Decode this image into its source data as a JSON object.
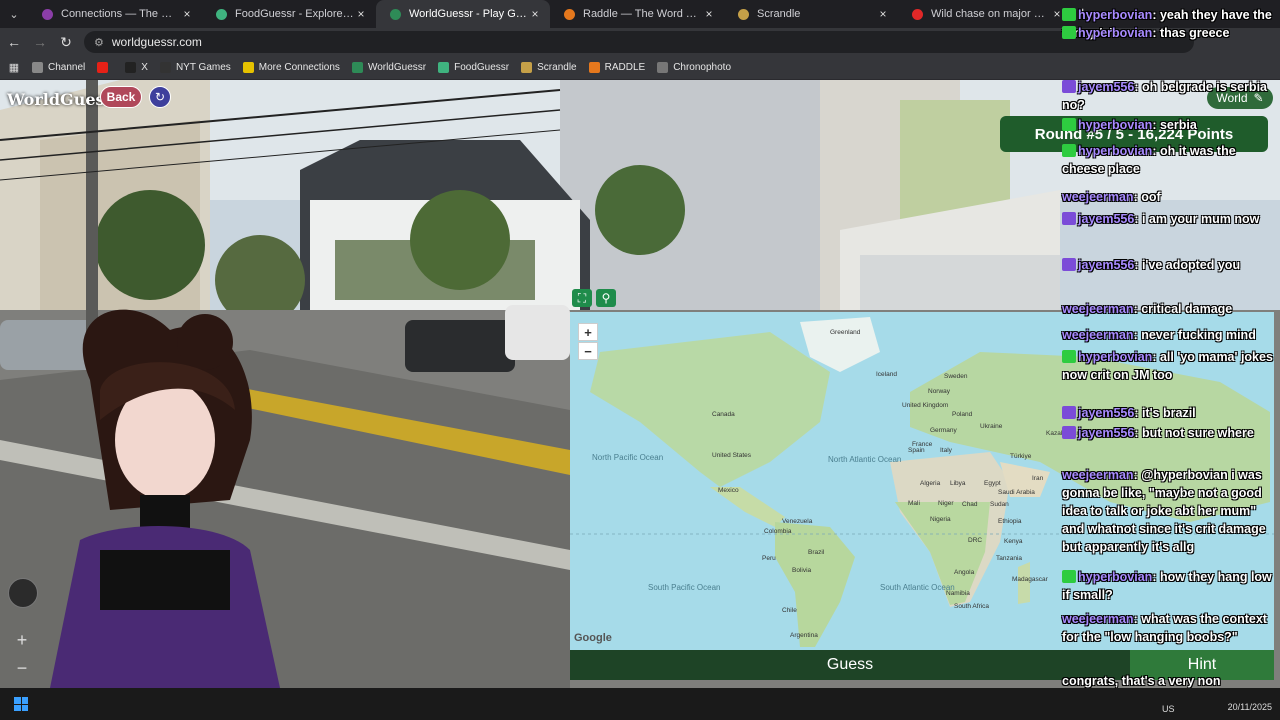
{
  "browser": {
    "tabs": [
      {
        "title": "Connections — The New York T",
        "color": "#8b3ea8"
      },
      {
        "title": "FoodGuessr - Explore the world",
        "color": "#3fb37f"
      },
      {
        "title": "WorldGuessr - Play Geoguessr",
        "color": "#2e8b57",
        "active": true
      },
      {
        "title": "Raddle — The Word Transforma",
        "color": "#e5781d"
      },
      {
        "title": "Scrandle",
        "color": "#c5a048"
      },
      {
        "title": "Wild chase on major Perth high",
        "color": "#e12828"
      }
    ],
    "address": "worldguessr.com",
    "bookmarks": [
      {
        "label": "Channel",
        "color": "#888"
      },
      {
        "label": "",
        "color": "#e62117"
      },
      {
        "label": "X",
        "color": "#222"
      },
      {
        "label": "NYT Games",
        "color": "#333"
      },
      {
        "label": "More Connections",
        "color": "#e6c200"
      },
      {
        "label": "WorldGuessr",
        "color": "#2e8b57"
      },
      {
        "label": "FoodGuessr",
        "color": "#3fb37f"
      },
      {
        "label": "Scrandle",
        "color": "#c5a048"
      },
      {
        "label": "RADDLE",
        "color": "#e5781d"
      },
      {
        "label": "Chronophoto",
        "color": "#777"
      }
    ]
  },
  "game": {
    "logo": "WorldGuessr",
    "back_label": "Back",
    "world_label": "World",
    "round_banner": "Round #5 / 5 - 16,224 Points",
    "guess_label": "Guess",
    "hint_label": "Hint",
    "map_attribution": "Google"
  },
  "map_labels": {
    "greenland": "Greenland",
    "iceland": "Iceland",
    "sweden": "Sweden",
    "norway": "Norway",
    "canada": "Canada",
    "united_kingdom": "United Kingdom",
    "poland": "Poland",
    "germany": "Germany",
    "france": "France",
    "ukraine": "Ukraine",
    "kazakhstan": "Kazakhstan",
    "spain": "Spain",
    "italy": "Italy",
    "turkiye": "Türkiye",
    "united_states": "United States",
    "north_pacific": "North Pacific Ocean",
    "north_atlantic": "North Atlantic Ocean",
    "mexico": "Mexico",
    "algeria": "Algeria",
    "libya": "Libya",
    "egypt": "Egypt",
    "saudi_arabia": "Saudi Arabia",
    "iran": "Iran",
    "mali": "Mali",
    "niger": "Niger",
    "chad": "Chad",
    "sudan": "Sudan",
    "nigeria": "Nigeria",
    "ethiopia": "Ethiopia",
    "venezuela": "Venezuela",
    "colombia": "Colombia",
    "drc": "DRC",
    "kenya": "Kenya",
    "tanzania": "Tanzania",
    "peru": "Peru",
    "brazil": "Brazil",
    "bolivia": "Bolivia",
    "angola": "Angola",
    "namibia": "Namibia",
    "south_africa": "South Africa",
    "madagascar": "Madagascar",
    "chile": "Chile",
    "argentina": "Argentina",
    "south_pacific": "South Pacific Ocean",
    "south_atlantic": "South Atlantic Ocean"
  },
  "chat": [
    {
      "user": "hyperbovian",
      "text": "yeah they have the funny 'a's",
      "badge": "#2ecc40"
    },
    {
      "user": "hyperbovian",
      "text": "thas greece",
      "badge": "#2ecc40"
    },
    {
      "user": "jayem556",
      "text": "oh belgrade is serbia no?",
      "badge": "#7b4cd8"
    },
    {
      "user": "hyperbovian",
      "text": "serbia",
      "badge": "#2ecc40"
    },
    {
      "user": "hyperbovian",
      "text": "oh it was the cheese place",
      "badge": "#2ecc40"
    },
    {
      "user": "weejeerman",
      "text": "oof",
      "badge": ""
    },
    {
      "user": "jayem556",
      "text": "i am your mum now",
      "badge": "#7b4cd8"
    },
    {
      "user": "jayem556",
      "text": "i've adopted you",
      "badge": "#7b4cd8"
    },
    {
      "user": "weejeerman",
      "text": "critical damage",
      "badge": ""
    },
    {
      "user": "weejeerman",
      "text": "never fucking mind",
      "badge": ""
    },
    {
      "user": "hyperbovian",
      "text": "all 'yo mama' jokes now crit on JM too",
      "badge": "#2ecc40"
    },
    {
      "user": "jayem556",
      "text": "it's brazil",
      "badge": "#7b4cd8"
    },
    {
      "user": "jayem556",
      "text": "but not sure where",
      "badge": "#7b4cd8"
    },
    {
      "user": "weejeerman",
      "text": "@hyperbovian i was gonna be like, \"maybe not a good idea to talk or joke abt her mum\" and whatnot since it's crit damage but apparently it's allg",
      "badge": ""
    },
    {
      "user": "hyperbovian",
      "text": "how they hang low if small?",
      "badge": "#2ecc40"
    },
    {
      "user": "weejeerman",
      "text": "what was the context for the \"low hanging boobs?\"",
      "badge": ""
    },
    {
      "user": "",
      "text": "congrats, that's a very non destructive way to cope",
      "badge": ""
    }
  ],
  "taskbar": {
    "region": "US",
    "date": "20/11/2025"
  }
}
